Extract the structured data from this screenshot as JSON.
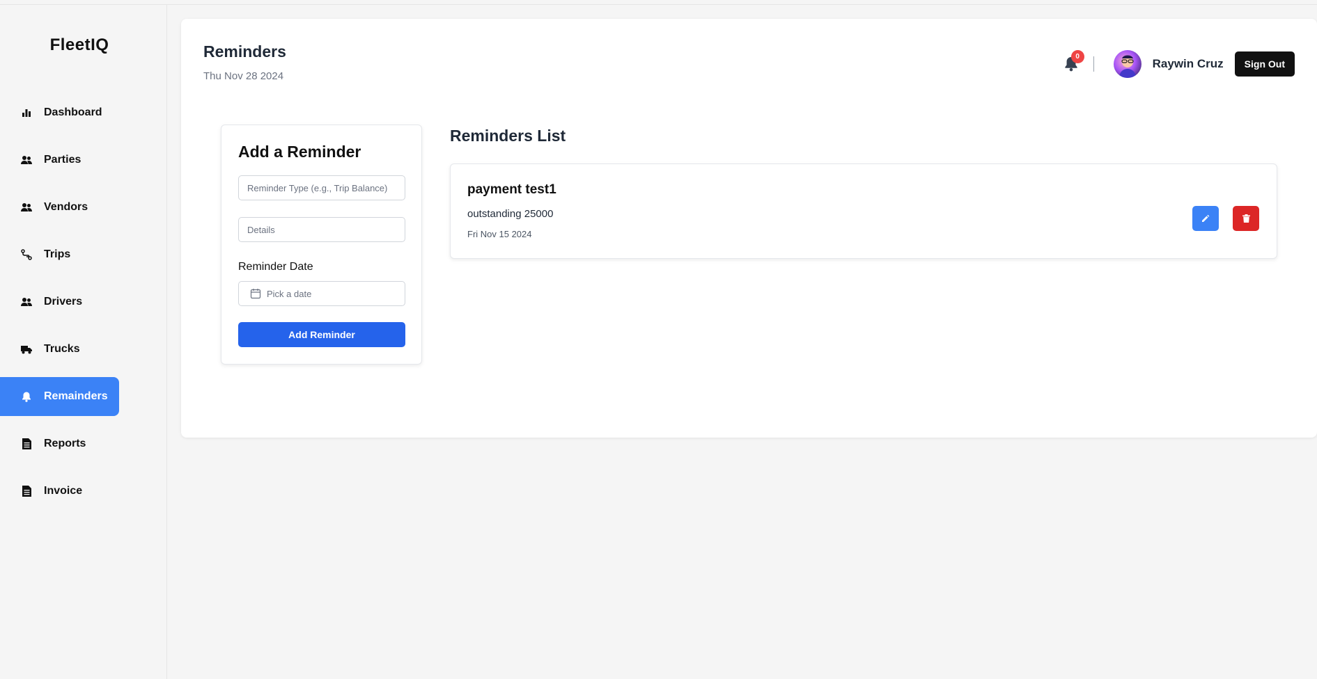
{
  "app": {
    "brand": "FleetIQ"
  },
  "sidebar": {
    "items": [
      {
        "label": "Dashboard",
        "icon": "bar-chart-icon",
        "active": false
      },
      {
        "label": "Parties",
        "icon": "users-icon",
        "active": false
      },
      {
        "label": "Vendors",
        "icon": "users-icon",
        "active": false
      },
      {
        "label": "Trips",
        "icon": "route-icon",
        "active": false
      },
      {
        "label": "Drivers",
        "icon": "users-icon",
        "active": false
      },
      {
        "label": "Trucks",
        "icon": "truck-icon",
        "active": false
      },
      {
        "label": "Remainders",
        "icon": "bell-icon",
        "active": true
      },
      {
        "label": "Reports",
        "icon": "document-icon",
        "active": false
      },
      {
        "label": "Invoice",
        "icon": "document-icon",
        "active": false
      }
    ]
  },
  "header": {
    "title": "Reminders",
    "date": "Thu Nov 28 2024",
    "notification_count": "0",
    "user_name": "Raywin Cruz",
    "sign_out_label": "Sign Out"
  },
  "add_form": {
    "title": "Add a Reminder",
    "type_placeholder": "Reminder Type (e.g., Trip Balance)",
    "details_placeholder": "Details",
    "date_label": "Reminder Date",
    "date_placeholder": "Pick a date",
    "submit_label": "Add Reminder"
  },
  "list": {
    "title": "Reminders List",
    "items": [
      {
        "type": "payment test1",
        "details": "outstanding 25000",
        "date": "Fri Nov 15 2024"
      }
    ]
  },
  "colors": {
    "accent": "#3b82f6",
    "primary_button": "#2563eb",
    "danger": "#dc2626",
    "badge": "#ef4444"
  }
}
